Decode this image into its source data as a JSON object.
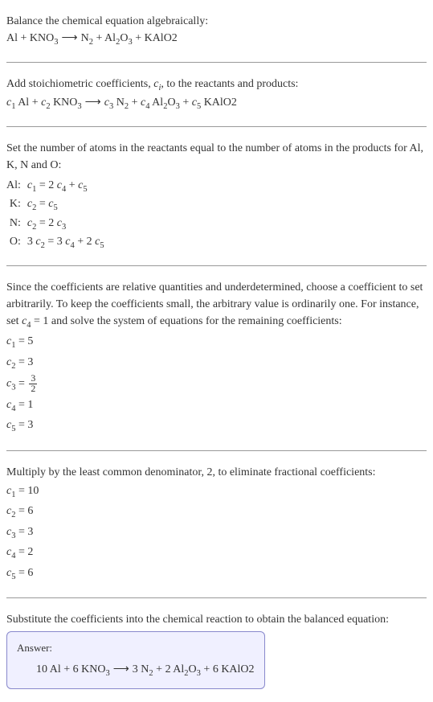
{
  "section1": {
    "line1": "Balance the chemical equation algebraically:",
    "eq": "Al + KNO₃  ⟶  N₂ + Al₂O₃ + KAlO2"
  },
  "section2": {
    "line1_prefix": "Add stoichiometric coefficients, ",
    "line1_var": "cᵢ",
    "line1_suffix": ", to the reactants and products:",
    "eq_c1": "c₁",
    "eq_al": " Al + ",
    "eq_c2": "c₂",
    "eq_kno3": " KNO₃  ⟶  ",
    "eq_c3": "c₃",
    "eq_n2": " N₂ + ",
    "eq_c4": "c₄",
    "eq_al2o3": " Al₂O₃ + ",
    "eq_c5": "c₅",
    "eq_kalo2": " KAlO2"
  },
  "section3": {
    "intro": "Set the number of atoms in the reactants equal to the number of atoms in the products for Al, K, N and O:",
    "rows": [
      {
        "label": "Al:",
        "eq": "c₁ = 2 c₄ + c₅"
      },
      {
        "label": "K:",
        "eq": "c₂ = c₅"
      },
      {
        "label": "N:",
        "eq": "c₂ = 2 c₃"
      },
      {
        "label": "O:",
        "eq": "3 c₂ = 3 c₄ + 2 c₅"
      }
    ]
  },
  "section4": {
    "intro": "Since the coefficients are relative quantities and underdetermined, choose a coefficient to set arbitrarily. To keep the coefficients small, the arbitrary value is ordinarily one. For instance, set c₄ = 1 and solve the system of equations for the remaining coefficients:",
    "c1": "c₁ = 5",
    "c2": "c₂ = 3",
    "c3_prefix": "c₃ = ",
    "c3_num": "3",
    "c3_den": "2",
    "c4": "c₄ = 1",
    "c5": "c₅ = 3"
  },
  "section5": {
    "intro": "Multiply by the least common denominator, 2, to eliminate fractional coefficients:",
    "c1": "c₁ = 10",
    "c2": "c₂ = 6",
    "c3": "c₃ = 3",
    "c4": "c₄ = 2",
    "c5": "c₅ = 6"
  },
  "section6": {
    "intro": "Substitute the coefficients into the chemical reaction to obtain the balanced equation:",
    "answer_label": "Answer:",
    "answer_eq": "10 Al + 6 KNO₃  ⟶  3 N₂ + 2 Al₂O₃ + 6 KAlO2"
  }
}
